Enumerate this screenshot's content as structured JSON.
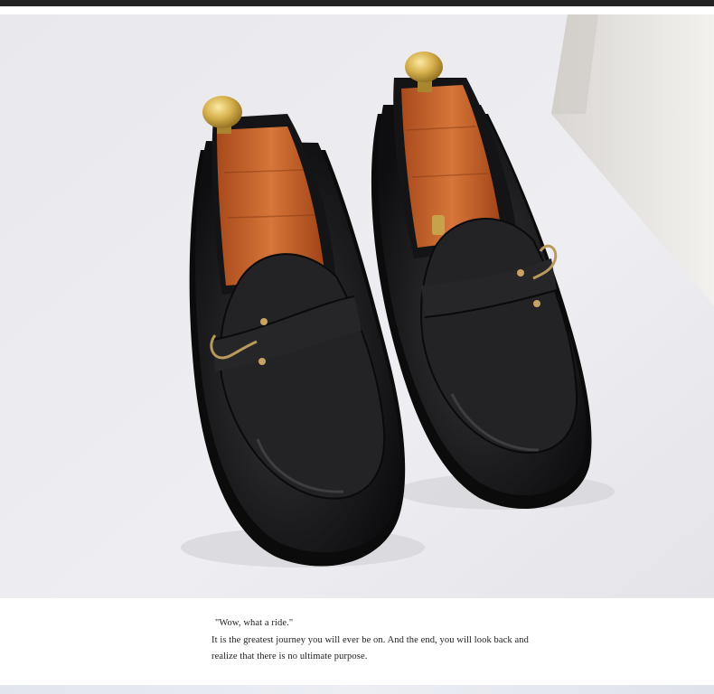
{
  "caption": {
    "quote": "\"Wow, what a ride.\"",
    "line1": "It is the greatest journey you will ever be on. And the end, you will look back and",
    "line2": "realize that there is no ultimate purpose."
  },
  "colors": {
    "background": "#ebebef",
    "leather": "#1b1b1d",
    "shoe_tree_wood": "#c8612a",
    "brass_knob": "#d8b650",
    "top_bar": "#222222"
  }
}
